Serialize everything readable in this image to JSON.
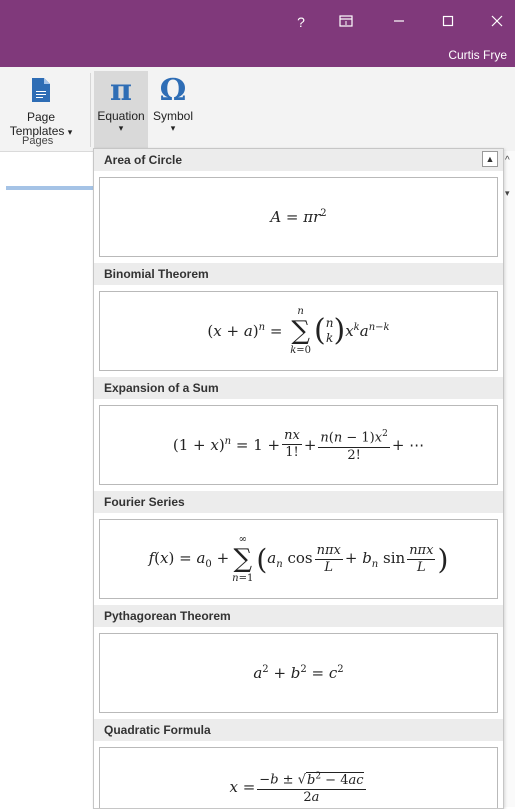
{
  "titlebar": {
    "help_icon": "?",
    "user_name": "Curtis Frye"
  },
  "ribbon": {
    "page_templates_label_1": "Page",
    "page_templates_label_2": "Templates",
    "pages_group_label": "Pages",
    "equation_label": "Equation",
    "symbol_label": "Symbol",
    "equation_icon": "π",
    "symbol_icon": "Ω",
    "caret": "▾"
  },
  "gallery": {
    "categories": [
      {
        "title": "Area of Circle"
      },
      {
        "title": "Binomial Theorem"
      },
      {
        "title": "Expansion of a Sum"
      },
      {
        "title": "Fourier Series"
      },
      {
        "title": "Pythagorean Theorem"
      },
      {
        "title": "Quadratic Formula"
      }
    ],
    "scroll_up_glyph": "▲"
  },
  "colors": {
    "titlebar": "#80397b",
    "ribbon": "#f3f3f3",
    "accent_blue": "#2e6db5"
  }
}
